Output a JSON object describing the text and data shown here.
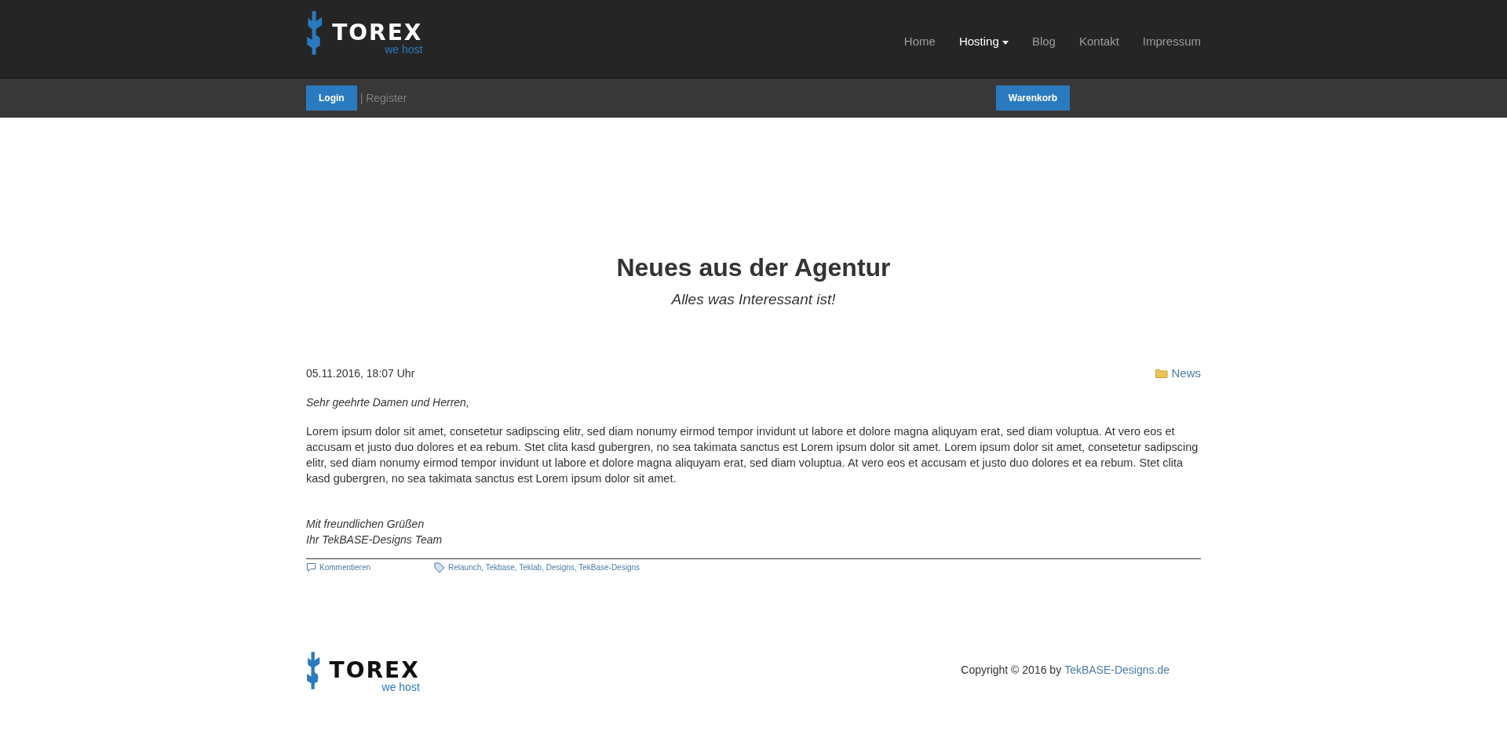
{
  "header": {
    "logo": {
      "name": "TOREX",
      "tagline": "we host"
    },
    "nav": [
      {
        "label": "Home",
        "selected": false,
        "dropdown": false
      },
      {
        "label": "Hosting",
        "selected": true,
        "dropdown": true
      },
      {
        "label": "Blog",
        "selected": false,
        "dropdown": false
      },
      {
        "label": "Kontakt",
        "selected": false,
        "dropdown": false
      },
      {
        "label": "Impressum",
        "selected": false,
        "dropdown": false
      }
    ]
  },
  "subbar": {
    "login": "Login",
    "register": "| Register",
    "cart": "Warenkorb"
  },
  "page": {
    "title": "Neues aus der Agentur",
    "subtitle": "Alles was Interessant ist!"
  },
  "post": {
    "date": "05.11.2016, 18:07 Uhr",
    "category": "News",
    "greeting": "Sehr geehrte Damen und Herren,",
    "body": "Lorem ipsum dolor sit amet, consetetur sadipscing elitr, sed diam nonumy eirmod tempor invidunt ut labore et dolore magna aliquyam erat, sed diam voluptua. At vero eos et accusam et justo duo dolores et ea rebum. Stet clita kasd gubergren, no sea takimata sanctus est Lorem ipsum dolor sit amet. Lorem ipsum dolor sit amet, consetetur sadipscing elitr, sed diam nonumy eirmod tempor invidunt ut labore et dolore magna aliquyam erat, sed diam voluptua. At vero eos et accusam et justo duo dolores et ea rebum. Stet clita kasd gubergren, no sea takimata sanctus est Lorem ipsum dolor sit amet.",
    "closing": [
      "Mit freundlichen Grüßen",
      "Ihr TekBASE-Designs Team"
    ],
    "comment_link": "Kommentieren",
    "tags": "Relaunch, Tekbase, Teklab, Designs, TekBase-Designs"
  },
  "footer": {
    "logo": {
      "name": "TOREX",
      "tagline": "we host"
    },
    "copyright": "Copyright © 2016 by",
    "copyright_link": "TekBASE-Designs.de"
  }
}
